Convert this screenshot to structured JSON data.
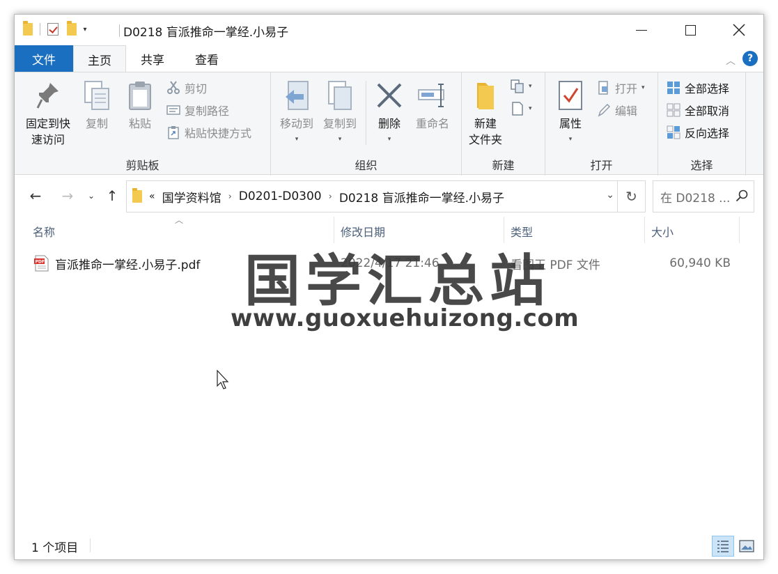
{
  "window": {
    "title": "D0218 盲派推命一掌经.小易子"
  },
  "ribbon_tabs": {
    "file": "文件",
    "home": "主页",
    "share": "共享",
    "view": "查看"
  },
  "ribbon": {
    "clipboard": {
      "label": "剪贴板",
      "pin": "固定到快速访问",
      "pin_line1": "固定到快",
      "pin_line2": "速访问",
      "copy": "复制",
      "paste": "粘贴",
      "cut": "剪切",
      "copy_path": "复制路径",
      "paste_shortcut": "粘贴快捷方式"
    },
    "organize": {
      "label": "组织",
      "move_to": "移动到",
      "copy_to": "复制到",
      "delete": "删除",
      "rename": "重命名"
    },
    "new": {
      "label": "新建",
      "new_folder_line1": "新建",
      "new_folder_line2": "文件夹"
    },
    "open": {
      "label": "打开",
      "properties": "属性",
      "open": "打开",
      "edit": "编辑"
    },
    "select": {
      "label": "选择",
      "select_all": "全部选择",
      "select_none": "全部取消",
      "invert": "反向选择"
    }
  },
  "address": {
    "overflow": "«",
    "crumbs": [
      "国学资料馆",
      "D0201-D0300",
      "D0218 盲派推命一掌经.小易子"
    ]
  },
  "search": {
    "placeholder": "在 D0218 ..."
  },
  "columns": {
    "name": "名称",
    "date": "修改日期",
    "type": "类型",
    "size": "大小"
  },
  "files": [
    {
      "name": "盲派推命一掌经.小易子.pdf",
      "date": "2022/4/17 21:46",
      "type": "看图王 PDF 文件",
      "size": "60,940 KB"
    }
  ],
  "watermark": {
    "title": "国学汇总站",
    "url": "www.guoxuehuizong.com"
  },
  "status": {
    "count": "1 个项目"
  },
  "colors": {
    "accent": "#1a6fc0",
    "ribbon_bg": "#f5f6f7",
    "column_header": "#4c607a"
  }
}
